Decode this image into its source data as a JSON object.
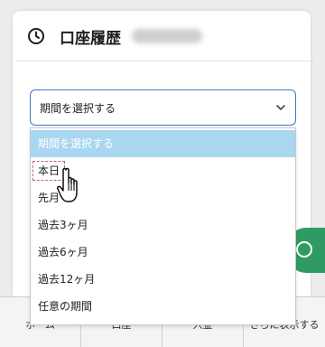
{
  "card": {
    "title": "口座履歴",
    "icon": "clock-icon"
  },
  "period_select": {
    "value": "期間を選択する",
    "icon": "chevron-down-icon"
  },
  "dropdown": {
    "options": [
      {
        "label": "期間を選択する",
        "selected": true
      },
      {
        "label": "本日",
        "selected": false
      },
      {
        "label": "先月",
        "selected": false
      },
      {
        "label": "過去3ヶ月",
        "selected": false
      },
      {
        "label": "過去6ヶ月",
        "selected": false
      },
      {
        "label": "過去12ヶ月",
        "selected": false
      },
      {
        "label": "任意の期間",
        "selected": false
      }
    ],
    "selected_color": "#a9d7f0"
  },
  "bottom_nav": {
    "items": [
      "ホーム",
      "口座",
      "入金",
      "さらに表示する"
    ]
  },
  "colors": {
    "accent_border": "#3a79c5",
    "fab_green": "#2f9b62"
  }
}
